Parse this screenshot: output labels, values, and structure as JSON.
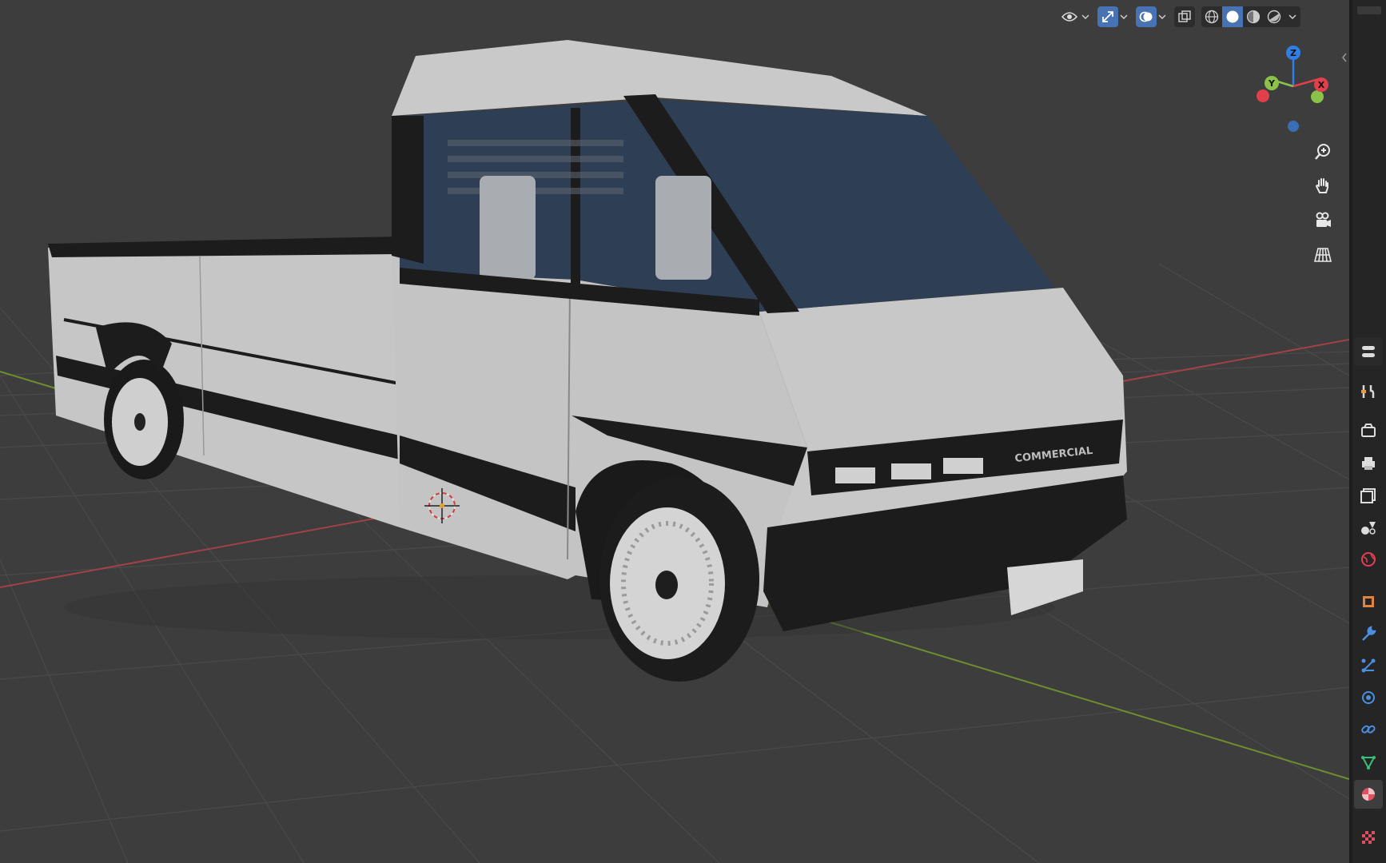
{
  "app": "Blender",
  "viewport": {
    "header": {
      "visibility_icon": "eye-icon",
      "gizmo_toggle": {
        "icon": "gizmo-arrows-icon",
        "active": true
      },
      "overlay_toggle": {
        "icon": "overlay-circles-icon",
        "active": true
      },
      "xray_toggle": {
        "icon": "xray-icon",
        "active": false
      },
      "shading_modes": [
        {
          "name": "wireframe",
          "icon": "wireframe-sphere-icon",
          "active": false
        },
        {
          "name": "solid",
          "icon": "solid-sphere-icon",
          "active": true
        },
        {
          "name": "material-preview",
          "icon": "material-sphere-icon",
          "active": false
        },
        {
          "name": "rendered",
          "icon": "rendered-sphere-icon",
          "active": false
        }
      ]
    },
    "navigation_gizmo": {
      "axes": [
        {
          "label": "Z",
          "color": "#2f7fe6"
        },
        {
          "label": "Y",
          "color": "#8bc34a"
        },
        {
          "label": "X",
          "color": "#e0404a"
        }
      ]
    },
    "nav_buttons": [
      {
        "name": "zoom",
        "icon": "zoom-in-icon"
      },
      {
        "name": "pan",
        "icon": "hand-icon"
      },
      {
        "name": "camera",
        "icon": "camera-icon"
      },
      {
        "name": "perspective",
        "icon": "grid-perspective-icon"
      }
    ],
    "colors": {
      "background": "#3d3d3d",
      "grid": "#4a4a4a",
      "x_axis": "#a04248",
      "y_axis": "#6e8e2e",
      "active_blue": "#4772b3"
    },
    "vehicle": {
      "badge_text": "COMMERCIAL",
      "body_color": "#c4c4c4",
      "trim_color": "#1b1b1b",
      "glass_color": "#2e3e54"
    },
    "cursor_3d": "3d-cursor-icon"
  },
  "properties_tabs": [
    {
      "name": "tool",
      "icon": "tool-icon",
      "active": false
    },
    {
      "name": "render",
      "icon": "render-camera-icon",
      "active": false
    },
    {
      "name": "output",
      "icon": "printer-icon",
      "active": false
    },
    {
      "name": "view-layer",
      "icon": "image-stack-icon",
      "active": false
    },
    {
      "name": "scene",
      "icon": "scene-icon",
      "active": false
    },
    {
      "name": "world",
      "icon": "world-icon",
      "active": false
    },
    {
      "name": "object",
      "icon": "object-cube-icon",
      "active": false
    },
    {
      "name": "modifiers",
      "icon": "wrench-icon",
      "active": false
    },
    {
      "name": "particles",
      "icon": "particles-icon",
      "active": false
    },
    {
      "name": "physics",
      "icon": "physics-icon",
      "active": false
    },
    {
      "name": "constraints",
      "icon": "constraint-icon",
      "active": false
    },
    {
      "name": "data",
      "icon": "mesh-data-icon",
      "active": false
    },
    {
      "name": "material",
      "icon": "material-icon",
      "active": true
    },
    {
      "name": "texture",
      "icon": "checker-texture-icon",
      "active": false
    }
  ]
}
